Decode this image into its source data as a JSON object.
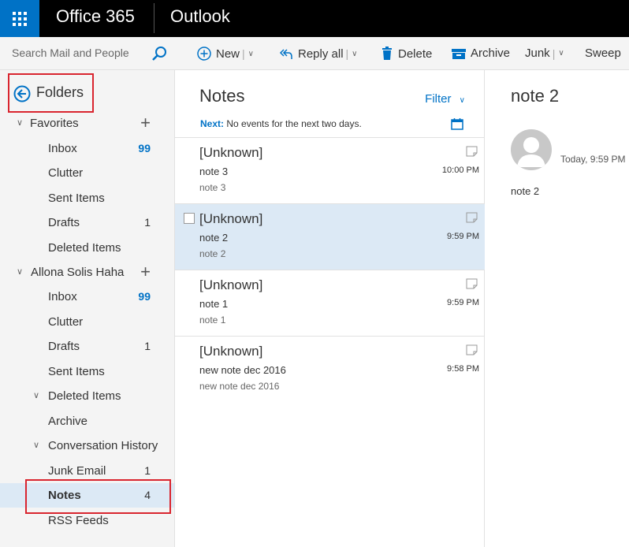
{
  "topbar": {
    "brand": "Office 365",
    "app": "Outlook"
  },
  "search": {
    "placeholder": "Search Mail and People"
  },
  "commands": {
    "new": "New",
    "reply_all": "Reply all",
    "delete": "Delete",
    "archive": "Archive",
    "junk": "Junk",
    "sweep": "Sweep"
  },
  "nav": {
    "folders_label": "Folders",
    "items": [
      {
        "label": "Favorites",
        "count": ""
      },
      {
        "label": "Inbox",
        "count": "99"
      },
      {
        "label": "Clutter",
        "count": ""
      },
      {
        "label": "Sent Items",
        "count": ""
      },
      {
        "label": "Drafts",
        "count": "1"
      },
      {
        "label": "Deleted Items",
        "count": ""
      },
      {
        "label": "Allona Solis Haha",
        "count": ""
      },
      {
        "label": "Inbox",
        "count": "99"
      },
      {
        "label": "Clutter",
        "count": ""
      },
      {
        "label": "Drafts",
        "count": "1"
      },
      {
        "label": "Sent Items",
        "count": ""
      },
      {
        "label": "Deleted Items",
        "count": ""
      },
      {
        "label": "Archive",
        "count": ""
      },
      {
        "label": "Conversation History",
        "count": ""
      },
      {
        "label": "Junk Email",
        "count": "1"
      },
      {
        "label": "Notes",
        "count": "4"
      },
      {
        "label": "RSS Feeds",
        "count": ""
      }
    ]
  },
  "list": {
    "title": "Notes",
    "filter": "Filter",
    "next_label": "Next:",
    "next_text": "No events for the next two days.",
    "messages": [
      {
        "from": "[Unknown]",
        "subject": "note 3",
        "preview": "note 3",
        "time": "10:00 PM"
      },
      {
        "from": "[Unknown]",
        "subject": "note 2",
        "preview": "note 2",
        "time": "9:59 PM"
      },
      {
        "from": "[Unknown]",
        "subject": "note 1",
        "preview": "note 1",
        "time": "9:59 PM"
      },
      {
        "from": "[Unknown]",
        "subject": "new note dec 2016",
        "preview": "new note dec 2016",
        "time": "9:58 PM"
      }
    ]
  },
  "reading": {
    "title": "note 2",
    "time": "Today, 9:59 PM",
    "body": "note 2"
  },
  "colors": {
    "accent": "#0072c6",
    "highlight": "#d9252f",
    "selected": "#dce9f5"
  }
}
